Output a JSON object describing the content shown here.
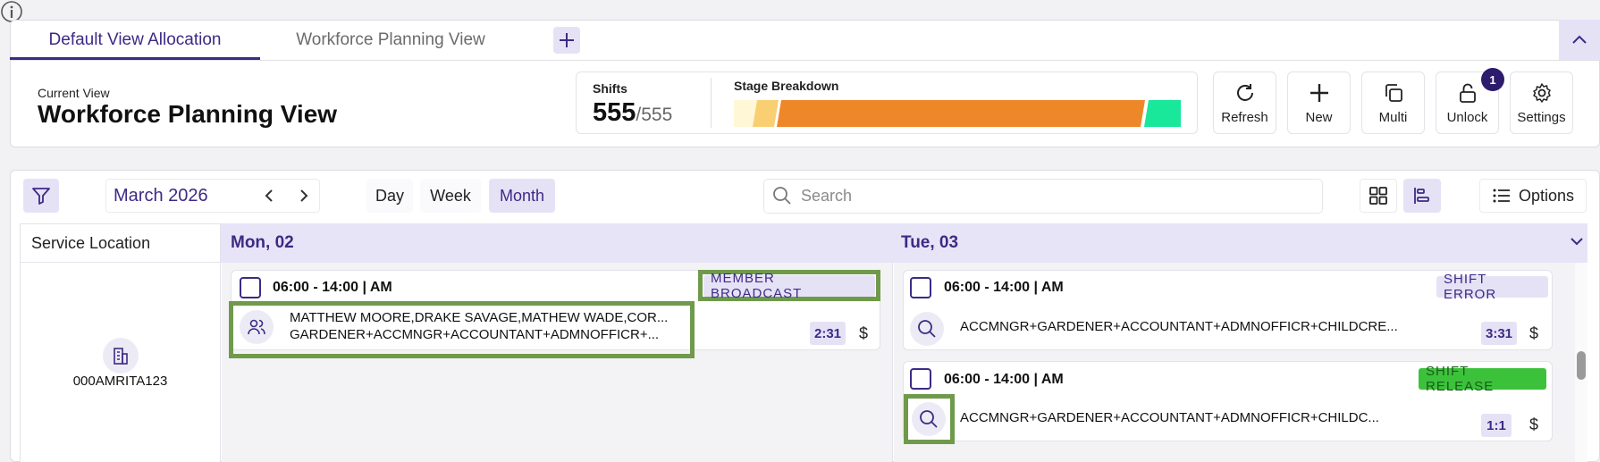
{
  "tabs": [
    {
      "label": "Default View Allocation",
      "active": true
    },
    {
      "label": "Workforce Planning View",
      "active": false
    }
  ],
  "current_view": {
    "label": "Current View",
    "title": "Workforce Planning View"
  },
  "stats": {
    "shifts_label": "Shifts",
    "shifts_value": "555",
    "shifts_total": "/555",
    "stage_label": "Stage Breakdown",
    "stage_colors": [
      "#fff7d6",
      "#f9cf72",
      "#ee8728",
      "#19e79a"
    ]
  },
  "actions": [
    {
      "label": "Refresh",
      "icon": "refresh-icon"
    },
    {
      "label": "New",
      "icon": "plus-icon"
    },
    {
      "label": "Multi",
      "icon": "copy-icon"
    },
    {
      "label": "Unlock",
      "icon": "lock-icon",
      "badge": "1"
    },
    {
      "label": "Settings",
      "icon": "gear-icon"
    }
  ],
  "toolbar": {
    "month": "March 2026",
    "views": [
      "Day",
      "Week",
      "Month"
    ],
    "active_view": "Month",
    "search_placeholder": "Search",
    "options_label": "Options"
  },
  "grid": {
    "service_header": "Service Location",
    "days": [
      "Mon, 02",
      "Tue, 03"
    ],
    "location": "000AMRITA123"
  },
  "shifts": [
    {
      "day": "Mon, 02",
      "time": "06:00 - 14:00 | AM",
      "status": "MEMBER BROADCAST",
      "line1": "MATTHEW MOORE,DRAKE SAVAGE,MATHEW WADE,COR...",
      "line2": "GARDENER+ACCMNGR+ACCOUNTANT+ADMNOFFICR+...",
      "count": "2:31",
      "currency": "$"
    },
    {
      "day": "Tue, 03",
      "time": "06:00 - 14:00 | AM",
      "status": "SHIFT ERROR",
      "line1": "ACCMNGR+GARDENER+ACCOUNTANT+ADMNOFFICR+CHILDCRE...",
      "count": "3:31",
      "currency": "$"
    },
    {
      "day": "Tue, 03",
      "time": "06:00 - 14:00 | AM",
      "status": "SHIFT RELEASE",
      "line1": "ACCMNGR+GARDENER+ACCOUNTANT+ADMNOFFICR+CHILDC...",
      "count": "1:1",
      "currency": "$"
    }
  ],
  "colors": {
    "accent": "#3d2a85",
    "highlight": "#6f9a4b",
    "release_green": "#3cc13b"
  }
}
